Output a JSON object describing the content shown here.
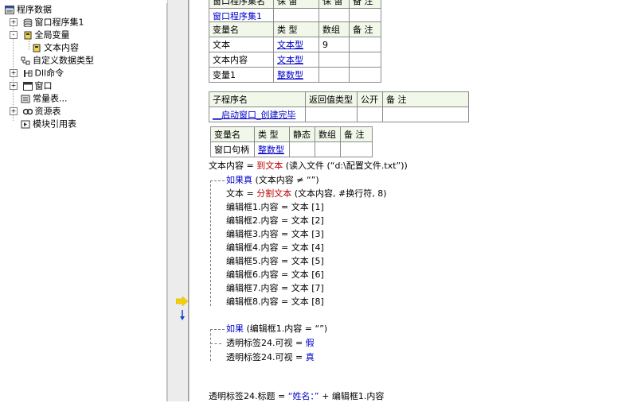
{
  "tree": {
    "root": "程序数据",
    "items": [
      {
        "label": "窗口程序集1",
        "expander": "+"
      },
      {
        "label": "全局变量",
        "expander": "-"
      },
      {
        "label": "文本内容",
        "expander": ""
      },
      {
        "label": "自定义数据类型",
        "expander": ""
      },
      {
        "label": "Dll命令",
        "expander": "+"
      },
      {
        "label": "窗口",
        "expander": "+"
      },
      {
        "label": "常量表...",
        "expander": ""
      },
      {
        "label": "资源表",
        "expander": "+"
      },
      {
        "label": "模块引用表",
        "expander": ""
      }
    ]
  },
  "table_assembly": {
    "headers": [
      "窗口程序集名",
      "保 留",
      "保 留",
      "备 注"
    ],
    "row": [
      "窗口程序集1",
      "",
      "",
      ""
    ]
  },
  "table_vars": {
    "headers": [
      "变量名",
      "类 型",
      "数组",
      "备 注"
    ],
    "rows": [
      [
        "文本",
        "文本型",
        "9",
        ""
      ],
      [
        "文本内容",
        "文本型",
        "",
        ""
      ],
      [
        "变量1",
        "整数型",
        "",
        ""
      ]
    ]
  },
  "table_sub": {
    "headers": [
      "子程序名",
      "返回值类型",
      "公开",
      "备 注"
    ],
    "row": [
      "__启动窗口_创建完毕",
      "",
      "",
      ""
    ]
  },
  "table_local": {
    "headers": [
      "变量名",
      "类 型",
      "静态",
      "数组",
      "备 注"
    ],
    "row": [
      "窗口句柄",
      "整数型",
      "",
      "",
      ""
    ]
  },
  "code": {
    "line1": {
      "lhs": "文本内容",
      "op": " = ",
      "fn": "到文本",
      "rest": " (读入文件 (“d:\\配置文件.txt”))"
    },
    "if1": {
      "kw": "如果真",
      "cond": " (文本内容 ≠ “”)"
    },
    "split": {
      "lhs": "文本",
      "op": " = ",
      "fn": "分割文本",
      "rest": " (文本内容, #换行符, 8)"
    },
    "assigns": [
      "编辑框1.内容 = 文本 [1]",
      "编辑框2.内容 = 文本 [2]",
      "编辑框3.内容 = 文本 [3]",
      "编辑框4.内容 = 文本 [4]",
      "编辑框5.内容 = 文本 [5]",
      "编辑框6.内容 = 文本 [6]",
      "编辑框7.内容 = 文本 [7]",
      "编辑框8.内容 = 文本 [8]"
    ],
    "if2": {
      "kw": "如果",
      "cond": " (编辑框1.内容 = “”)"
    },
    "vis1": {
      "lhs": "透明标签24.可视",
      "op": " = ",
      "val": "假"
    },
    "vis2": {
      "lhs": "透明标签24.可视",
      "op": " = ",
      "val": "真"
    },
    "last": {
      "lhs": "透明标签24.标题",
      "op": " = ",
      "str": "“姓名：”",
      "rest": " + 编辑框1.内容"
    }
  },
  "colors": {
    "header_bg": "#f1f7e9",
    "keyword": "#0000cc",
    "function": "#c00000",
    "arrow": "#f5d000"
  }
}
